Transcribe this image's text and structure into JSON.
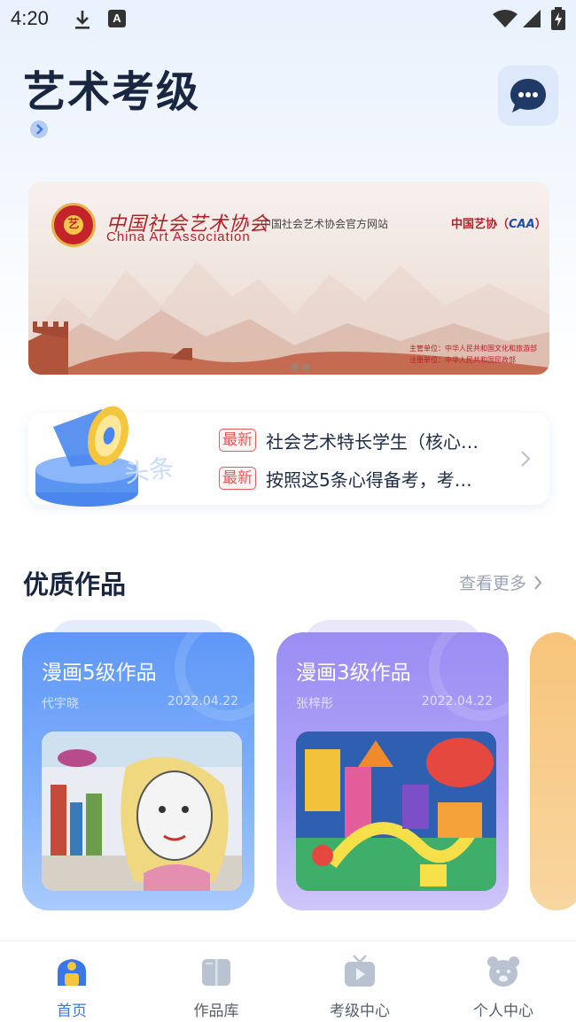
{
  "status_bar": {
    "time": "4:20",
    "a_icon": "A"
  },
  "header": {
    "title": "艺术考级"
  },
  "banner": {
    "logo_char": "艺",
    "org_cn": "中国社会艺术协会",
    "org_en": "China Art Association",
    "site_label": "中国社会艺术协会官方网站",
    "brand_cn": "中国艺协（",
    "brand_abbr": "CAA",
    "brand_close": "）",
    "org_line1": "主管单位：中华人民共和国文化和旅游部",
    "org_line2": "注册单位：中华人民共和国民政部",
    "page_count": 2,
    "current_page": 1
  },
  "news": {
    "items": [
      {
        "tag": "最新",
        "text": "社会艺术特长学生（核心…"
      },
      {
        "tag": "最新",
        "text": "按照这5条心得备考，考…"
      }
    ],
    "illus_text": "头条"
  },
  "section": {
    "title": "优质作品",
    "see_more": "查看更多"
  },
  "works": [
    {
      "title": "漫画5级作品",
      "author": "代宇晓",
      "date": "2022.04.22"
    },
    {
      "title": "漫画3级作品",
      "author": "张梓彤",
      "date": "2022.04.22"
    }
  ],
  "tabs": [
    {
      "label": "首页",
      "icon": "home-icon",
      "active": true
    },
    {
      "label": "作品库",
      "icon": "book-icon",
      "active": false
    },
    {
      "label": "考级中心",
      "icon": "tv-icon",
      "active": false
    },
    {
      "label": "个人中心",
      "icon": "bear-icon",
      "active": false
    }
  ],
  "colors": {
    "accent": "#3a76e6",
    "tag_red": "#e25b5b",
    "card_blue": "#5f97f7",
    "card_purple": "#9a8cf3"
  }
}
